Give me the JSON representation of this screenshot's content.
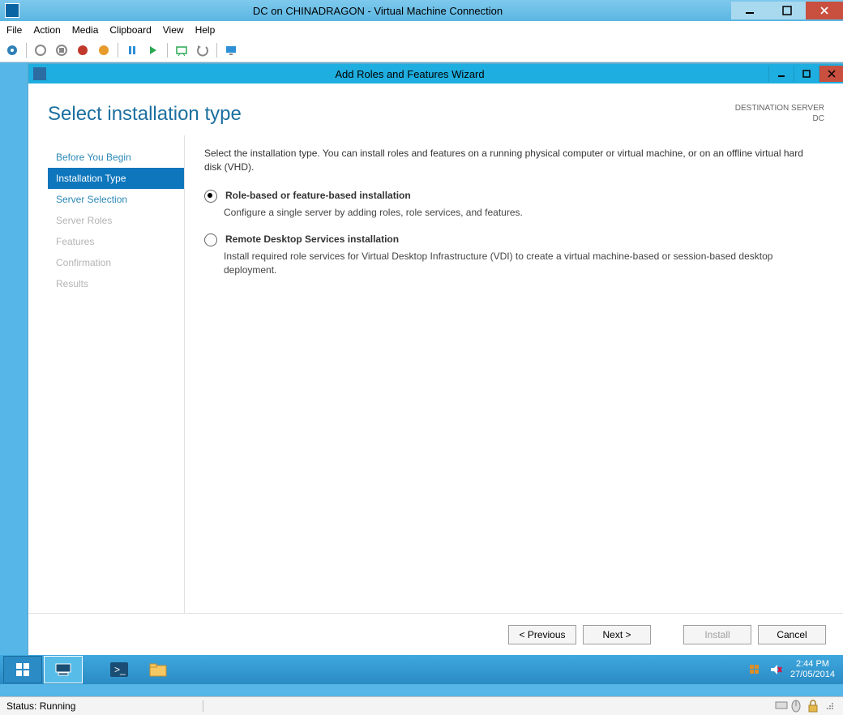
{
  "outer": {
    "title": "DC on CHINADRAGON - Virtual Machine Connection",
    "menubar": [
      "File",
      "Action",
      "Media",
      "Clipboard",
      "View",
      "Help"
    ],
    "status": "Status: Running"
  },
  "wizard": {
    "title": "Add Roles and Features Wizard",
    "heading": "Select installation type",
    "destination_label": "DESTINATION SERVER",
    "destination_value": "DC",
    "nav": [
      {
        "label": "Before You Begin",
        "state": "link"
      },
      {
        "label": "Installation Type",
        "state": "selected"
      },
      {
        "label": "Server Selection",
        "state": "link"
      },
      {
        "label": "Server Roles",
        "state": "disabled"
      },
      {
        "label": "Features",
        "state": "disabled"
      },
      {
        "label": "Confirmation",
        "state": "disabled"
      },
      {
        "label": "Results",
        "state": "disabled"
      }
    ],
    "intro": "Select the installation type. You can install roles and features on a running physical computer or virtual machine, or on an offline virtual hard disk (VHD).",
    "options": [
      {
        "title": "Role-based or feature-based installation",
        "desc": "Configure a single server by adding roles, role services, and features.",
        "selected": true
      },
      {
        "title": "Remote Desktop Services installation",
        "desc": "Install required role services for Virtual Desktop Infrastructure (VDI) to create a virtual machine-based or session-based desktop deployment.",
        "selected": false
      }
    ],
    "buttons": {
      "previous": "< Previous",
      "next": "Next >",
      "install": "Install",
      "cancel": "Cancel"
    }
  },
  "taskbar": {
    "time": "2:44 PM",
    "date": "27/05/2014"
  }
}
